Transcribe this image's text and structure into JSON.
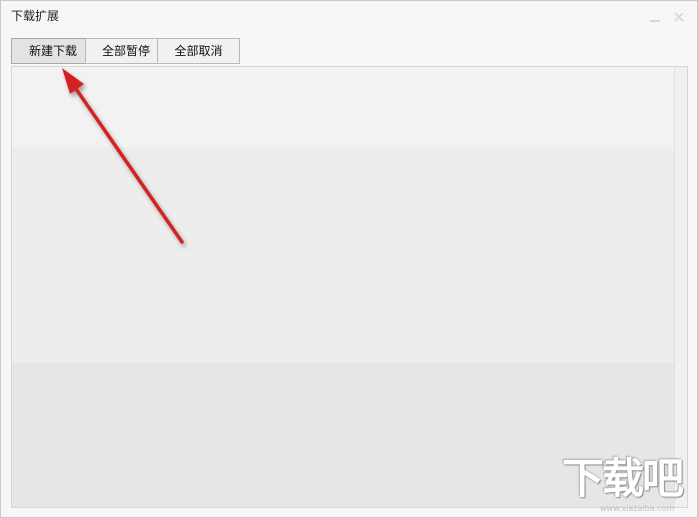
{
  "window": {
    "title": "下载扩展"
  },
  "icons": {
    "minimize": "minimize-icon",
    "close": "close-icon"
  },
  "toolbar": {
    "new_download_label": "新建下载",
    "pause_all_label": "全部暂停",
    "cancel_all_label": "全部取消"
  },
  "annotation": {
    "arrow_color": "#d42020"
  },
  "watermark": {
    "text": "下载吧",
    "url": "www.xiazaiba.com"
  }
}
